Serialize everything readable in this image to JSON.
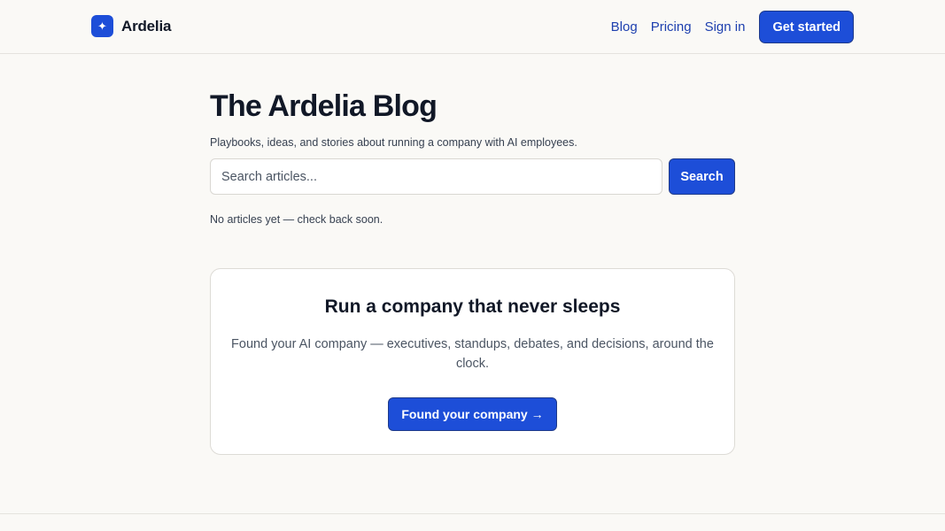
{
  "header": {
    "brand": {
      "name": "Ardelia",
      "logo_icon": "sparkle-icon",
      "logo_glyph": "✦",
      "logo_color": "#1d4ed8"
    },
    "nav": {
      "links": [
        "Blog",
        "Pricing",
        "Sign in"
      ],
      "cta_label": "Get started"
    }
  },
  "main": {
    "title": "The Ardelia Blog",
    "subtitle": "Playbooks, ideas, and stories about running a company with AI employees.",
    "search": {
      "placeholder": "Search articles...",
      "value": "",
      "button_label": "Search"
    },
    "empty_state": "No articles yet — check back soon."
  },
  "cta_card": {
    "title": "Run a company that never sleeps",
    "text": "Found your AI company — executives, standups, debates, and decisions, around the clock.",
    "button_label": "Found your company →"
  },
  "colors": {
    "accent": "#1d4ed8",
    "link": "#1e40af",
    "background": "#faf9f6"
  }
}
